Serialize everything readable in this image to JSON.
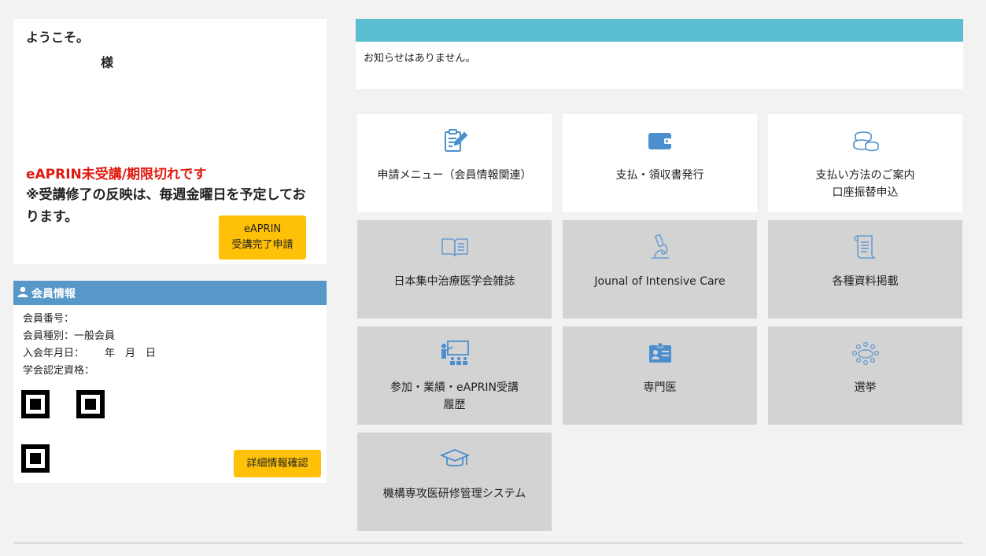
{
  "welcome": {
    "greeting": "ようこそ。",
    "honorific": "様",
    "alert": "eAPRIN未受講/期限切れです",
    "note": "※受講修了の反映は、毎週金曜日を予定しております。",
    "eaprin_button_line1": "eAPRIN",
    "eaprin_button_line2": "受講完了申請"
  },
  "member": {
    "title": "会員情報",
    "rows": [
      {
        "label": "会員番号：",
        "value": ""
      },
      {
        "label": "会員種別：",
        "value": "一般会員"
      },
      {
        "label": "入会年月日：",
        "value": "　　年　月　日"
      },
      {
        "label": "学会認定資格：",
        "value": ""
      }
    ],
    "detail_button": "詳細情報確認"
  },
  "notice": {
    "text": "お知らせはありません。"
  },
  "tiles": [
    {
      "label": "申請メニュー（会員情報関連）",
      "icon": "clipboard-edit-icon",
      "style": "white"
    },
    {
      "label": "支払・領収書発行",
      "icon": "wallet-icon",
      "style": "white"
    },
    {
      "label": "支払い方法のご案内\n口座振替申込",
      "icon": "coins-icon",
      "style": "white"
    },
    {
      "label": "日本集中治療医学会雑誌",
      "icon": "book-icon",
      "style": "gray"
    },
    {
      "label": "Jounal of Intensive Care",
      "icon": "microscope-icon",
      "style": "gray"
    },
    {
      "label": "各種資料掲載",
      "icon": "scroll-icon",
      "style": "gray"
    },
    {
      "label": "参加・業績・eAPRIN受講\n履歴",
      "icon": "lecture-icon",
      "style": "gray"
    },
    {
      "label": "専門医",
      "icon": "id-card-icon",
      "style": "gray"
    },
    {
      "label": "選挙",
      "icon": "meeting-icon",
      "style": "gray"
    },
    {
      "label": "機構専攻医研修管理システム",
      "icon": "graduation-cap-icon",
      "style": "gray"
    }
  ],
  "colors": {
    "alert": "#e0190f",
    "button": "#ffc107",
    "member_header": "#5798c9",
    "notice_bar": "#5bbdd0",
    "icon": "#4b8fce"
  }
}
